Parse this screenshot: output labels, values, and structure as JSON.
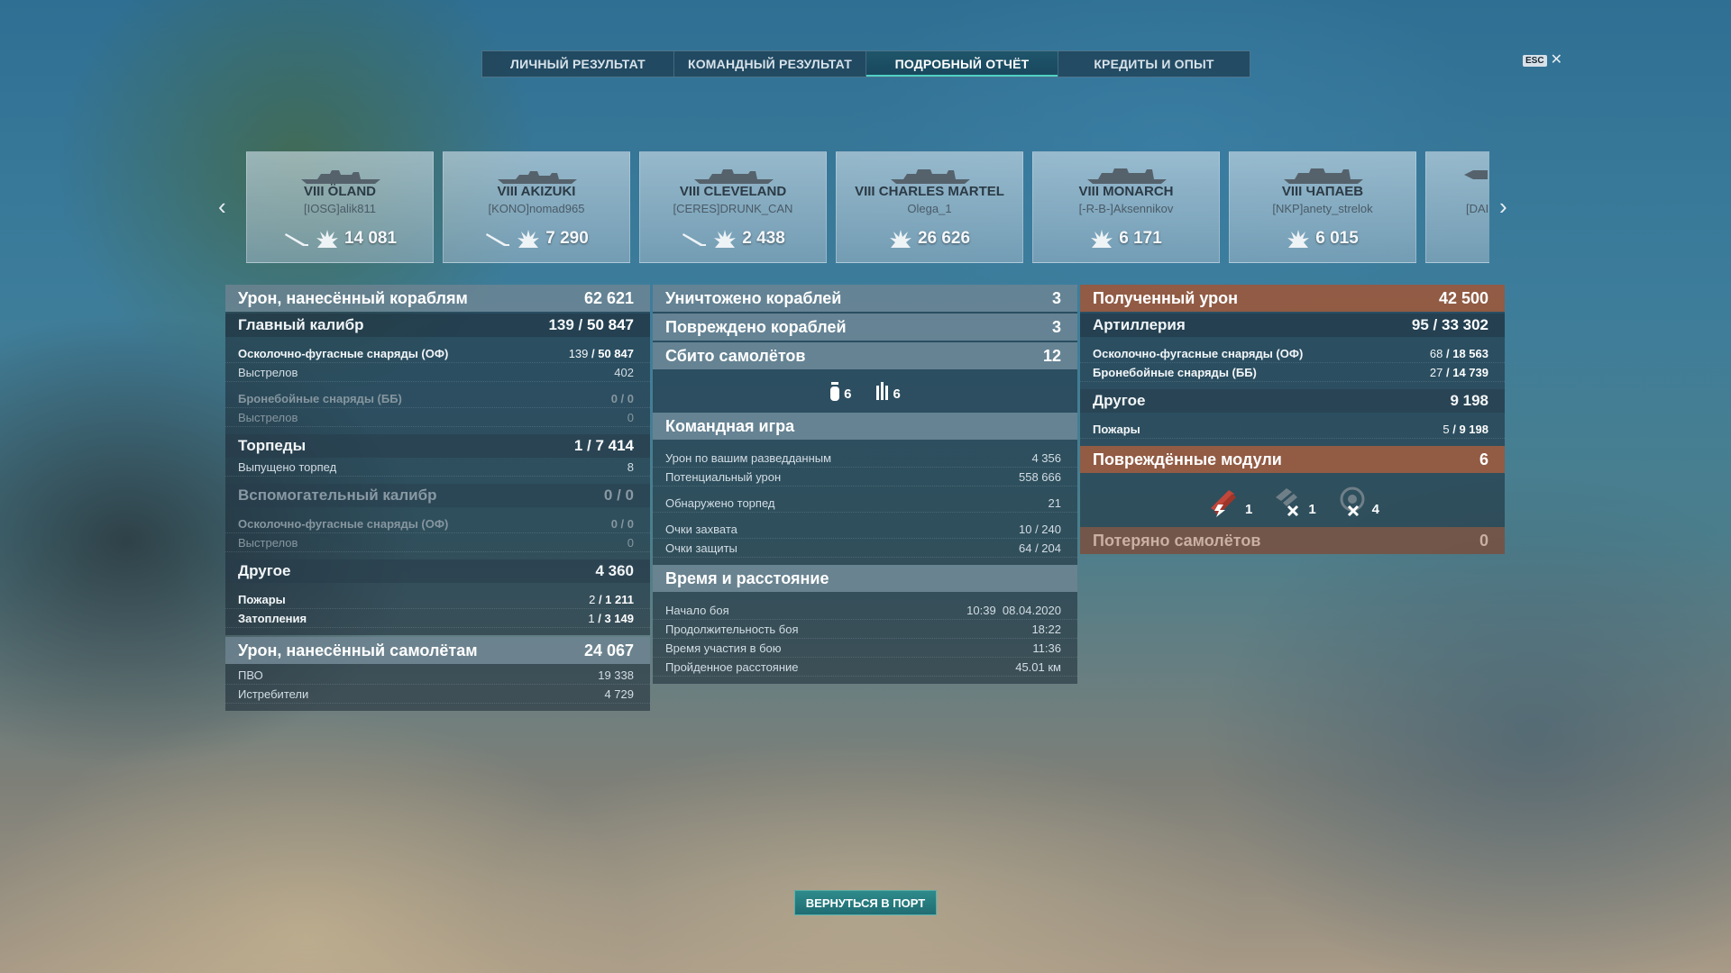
{
  "tabs": [
    {
      "label": "ЛИЧНЫЙ РЕЗУЛЬТАТ",
      "active": false
    },
    {
      "label": "КОМАНДНЫЙ РЕЗУЛЬТАТ",
      "active": false
    },
    {
      "label": "ПОДРОБНЫЙ ОТЧЁТ",
      "active": true
    },
    {
      "label": "КРЕДИТЫ И ОПЫТ",
      "active": false
    }
  ],
  "esc": {
    "key": "ESC",
    "icon": "close-icon"
  },
  "ships": [
    {
      "tier_name": "VIII ÖLAND",
      "player": "[IOSG]alik811",
      "damage": "14 081",
      "icons": [
        "torpedo-icon",
        "damage-icon"
      ]
    },
    {
      "tier_name": "VIII AKIZUKI",
      "player": "[KONO]nomad965",
      "damage": "7 290",
      "icons": [
        "torpedo-icon",
        "damage-icon"
      ]
    },
    {
      "tier_name": "VIII CLEVELAND",
      "player": "[CERES]DRUNK_CAN",
      "damage": "2 438",
      "icons": [
        "torpedo-icon",
        "damage-icon"
      ]
    },
    {
      "tier_name": "VIII CHARLES MARTEL",
      "player": "Olega_1",
      "damage": "26 626",
      "icons": [
        "damage-icon"
      ]
    },
    {
      "tier_name": "VIII MONARCH",
      "player": "[-R-B-]Aksennikov",
      "damage": "6 171",
      "icons": [
        "damage-icon"
      ]
    },
    {
      "tier_name": "VIII ЧАПАЕВ",
      "player": "[NKP]anety_strelok",
      "damage": "6 015",
      "icons": [
        "damage-icon"
      ]
    },
    {
      "tier_name": "",
      "player": "[DAI",
      "damage": "",
      "icons": []
    }
  ],
  "left": {
    "ship_damage": {
      "label": "Урон, нанесённый кораблям",
      "value": "62 621"
    },
    "main_battery": {
      "label": "Главный калибр",
      "hits": "139",
      "damage": "50 847"
    },
    "he_shells": {
      "label": "Осколочно-фугасные снаряды (ОФ)",
      "hits": "139",
      "damage": "50 847"
    },
    "he_shots": {
      "label": "Выстрелов",
      "value": "402"
    },
    "ap_shells": {
      "label": "Бронебойные снаряды (ББ)",
      "value": "0 / 0"
    },
    "ap_shots": {
      "label": "Выстрелов",
      "value": "0"
    },
    "torpedoes": {
      "label": "Торпеды",
      "hits": "1",
      "damage": "7 414"
    },
    "torp_launched": {
      "label": "Выпущено торпед",
      "value": "8"
    },
    "secondary": {
      "label": "Вспомогательный калибр",
      "value": "0 / 0"
    },
    "sec_he": {
      "label": "Осколочно-фугасные снаряды (ОФ)",
      "value": "0 / 0"
    },
    "sec_shots": {
      "label": "Выстрелов",
      "value": "0"
    },
    "other": {
      "label": "Другое",
      "value": "4 360"
    },
    "fires": {
      "label": "Пожары",
      "count": "2",
      "damage": "1 211"
    },
    "floods": {
      "label": "Затопления",
      "count": "1",
      "damage": "3 149"
    },
    "plane_damage": {
      "label": "Урон, нанесённый самолётам",
      "value": "24 067"
    },
    "aa": {
      "label": "ПВО",
      "value": "19 338"
    },
    "fighters": {
      "label": "Истребители",
      "value": "4 729"
    }
  },
  "middle": {
    "destroyed": {
      "label": "Уничтожено кораблей",
      "value": "3"
    },
    "damaged": {
      "label": "Повреждено кораблей",
      "value": "3"
    },
    "planes": {
      "label": "Сбито самолётов",
      "value": "12"
    },
    "plane_breakdown": [
      {
        "icon": "bomb-icon",
        "value": "6"
      },
      {
        "icon": "aa-gun-icon",
        "value": "6"
      }
    ],
    "team": {
      "label": "Командная игра",
      "rows": [
        {
          "label": "Урон по вашим разведданным",
          "value": "4 356"
        },
        {
          "label": "Потенциальный урон",
          "value": "558 666"
        },
        {
          "label": "Обнаружено торпед",
          "value": "21"
        },
        {
          "label": "Очки захвата",
          "value": "10 / 240"
        },
        {
          "label": "Очки защиты",
          "value": "64 / 204"
        }
      ]
    },
    "time": {
      "label": "Время и расстояние",
      "rows": [
        {
          "label": "Начало боя",
          "value": "10:39  08.04.2020"
        },
        {
          "label": "Продолжительность боя",
          "value": "18:22"
        },
        {
          "label": "Время участия в бою",
          "value": "11:36"
        },
        {
          "label": "Пройденное расстояние",
          "value": "45.01 км"
        }
      ]
    }
  },
  "right": {
    "received": {
      "label": "Полученный урон",
      "value": "42 500"
    },
    "artillery": {
      "label": "Артиллерия",
      "count": "95",
      "damage": "33 302"
    },
    "r_he": {
      "label": "Осколочно-фугасные снаряды (ОФ)",
      "count": "68",
      "damage": "18 563"
    },
    "r_ap": {
      "label": "Бронебойные снаряды (ББ)",
      "count": "27",
      "damage": "14 739"
    },
    "r_other": {
      "label": "Другое",
      "value": "9 198"
    },
    "r_fires": {
      "label": "Пожары",
      "count": "5",
      "damage": "9 198"
    },
    "modules": {
      "label": "Повреждённые модули",
      "value": "6"
    },
    "module_icons": [
      {
        "icon": "fire-module-icon",
        "value": "1"
      },
      {
        "icon": "torpedo-tube-module-icon",
        "value": "1"
      },
      {
        "icon": "turret-module-icon",
        "value": "4"
      }
    ],
    "lost_planes": {
      "label": "Потеряно самолётов",
      "value": "0"
    }
  },
  "footer": {
    "return_label": "ВЕРНУТЬСЯ В ПОРТ"
  }
}
